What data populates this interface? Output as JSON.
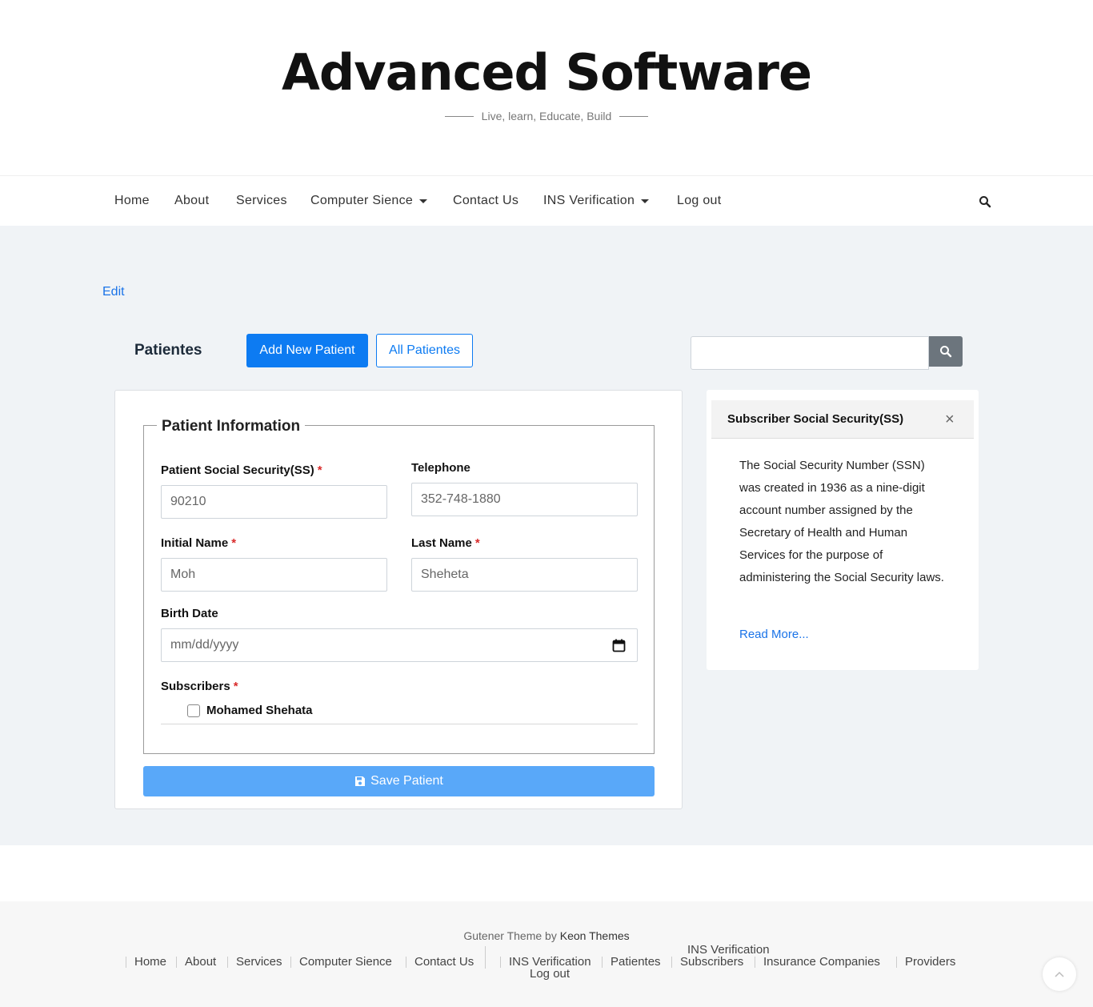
{
  "site": {
    "title": "Advanced Software",
    "tagline": "Live, learn, Educate, Build"
  },
  "nav": {
    "items": [
      {
        "label": "Home"
      },
      {
        "label": "About"
      },
      {
        "label": "Services"
      },
      {
        "label": "Computer Sience",
        "dropdown": true
      },
      {
        "label": "Contact Us"
      },
      {
        "label": "INS Verification",
        "dropdown": true
      },
      {
        "label": "Log out"
      }
    ],
    "search_icon": "search-icon"
  },
  "main": {
    "edit_label": "Edit",
    "section_title": "Patientes",
    "add_button": "Add New Patient",
    "all_button": "All Patientes",
    "search": {
      "value": "",
      "icon": "search-icon"
    }
  },
  "form": {
    "legend": "Patient Information",
    "ss_label": "Patient Social Security(SS)",
    "ss_value": "90210",
    "telephone_label": "Telephone",
    "telephone_value": "352-748-1880",
    "initial_label": "Initial Name",
    "initial_value": "Moh",
    "last_label": "Last Name",
    "last_value": "Sheheta",
    "birth_label": "Birth Date",
    "birth_placeholder": "mm/dd/yyyy",
    "subscribers_label": "Subscribers",
    "subscriber_option": "Mohamed Shehata",
    "subscriber_checked": false,
    "required_mark": "*",
    "save_button": "Save Patient"
  },
  "sidebar": {
    "title": "Subscriber Social Security(SS)",
    "close": "×",
    "text": "The Social Security Number (SSN) was created in 1936 as a nine-digit account number assigned by the Secretary of Health and Human Services for the purpose of administering the Social Security laws.",
    "read_more": "Read More..."
  },
  "footer": {
    "credit_prefix": "Gutener Theme by ",
    "credit_author": "Keon Themes",
    "links": {
      "home": "Home",
      "about": "About",
      "services": "Services",
      "computer": "Computer Sience",
      "contact": "Contact Us",
      "ins": "INS Verification",
      "patientes": "Patientes",
      "ins_top": "INS Verification",
      "subscribers": "Subscribers",
      "insurance": "Insurance Companies",
      "providers": "Providers",
      "logout": "Log out"
    }
  },
  "colors": {
    "primary": "#0d7bf2",
    "save_button": "#59a8f9",
    "background": "#f0f3f6",
    "required": "#d92b2b"
  }
}
